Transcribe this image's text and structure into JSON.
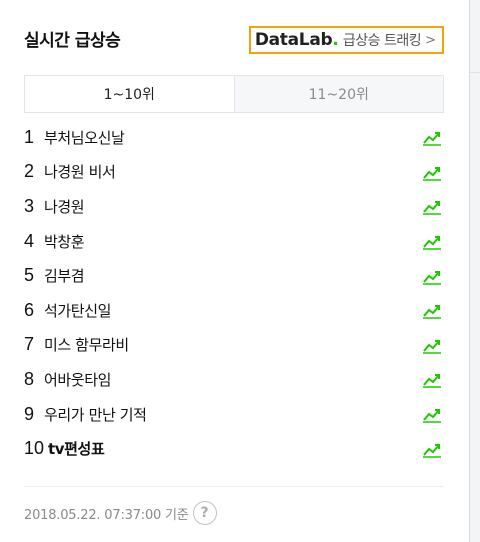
{
  "header": {
    "title": "실시간 급상승",
    "datalab_brand": "DataLab",
    "datalab_dot": ".",
    "datalab_sub": "급상승 트래킹",
    "datalab_chevron": ">"
  },
  "tabs": [
    {
      "label": "1~10위",
      "active": true
    },
    {
      "label": "11~20위",
      "active": false
    }
  ],
  "ranking": [
    {
      "rank": "1",
      "keyword": "부처님오신날",
      "icon": "trend-up-icon"
    },
    {
      "rank": "2",
      "keyword": "나경원 비서",
      "icon": "trend-up-icon"
    },
    {
      "rank": "3",
      "keyword": "나경원",
      "icon": "trend-up-icon"
    },
    {
      "rank": "4",
      "keyword": "박창훈",
      "icon": "trend-up-icon"
    },
    {
      "rank": "5",
      "keyword": "김부겸",
      "icon": "trend-up-icon"
    },
    {
      "rank": "6",
      "keyword": "석가탄신일",
      "icon": "trend-up-icon"
    },
    {
      "rank": "7",
      "keyword": "미스 함무라비",
      "icon": "trend-up-icon"
    },
    {
      "rank": "8",
      "keyword": "어바웃타임",
      "icon": "trend-up-icon"
    },
    {
      "rank": "9",
      "keyword": "우리가 만난 기적",
      "icon": "trend-up-icon"
    },
    {
      "rank": "10",
      "keyword": "tv편성표",
      "icon": "trend-up-icon"
    }
  ],
  "footer": {
    "timestamp": "2018.05.22. 07:37:00 기준",
    "help_icon_glyph": "?"
  },
  "colors": {
    "datalab_border": "#f2a20c",
    "brand_dot": "#1ec800",
    "trend_icon": "#1ec800"
  }
}
